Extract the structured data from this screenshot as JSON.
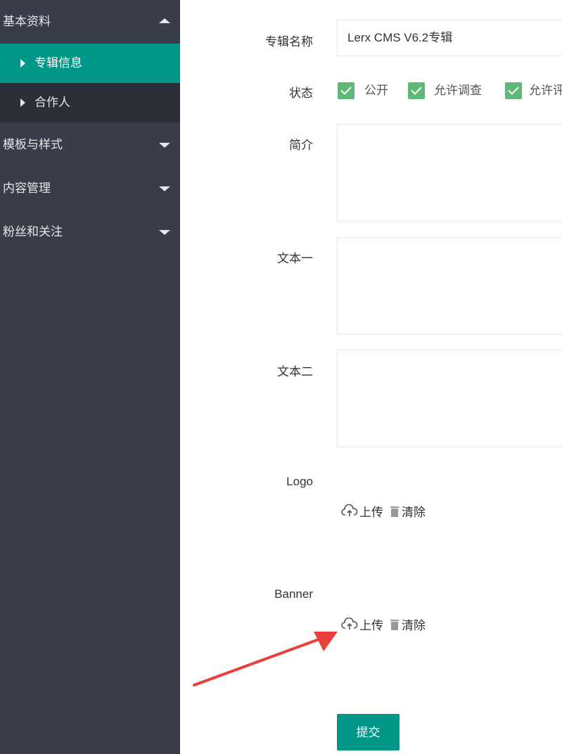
{
  "sidebar": {
    "groups": [
      {
        "label": "基本资料",
        "expanded": true,
        "children": [
          {
            "label": "专辑信息",
            "active": true
          },
          {
            "label": "合作人",
            "active": false
          }
        ]
      },
      {
        "label": "模板与样式",
        "expanded": false
      },
      {
        "label": "内容管理",
        "expanded": false
      },
      {
        "label": "粉丝和关注",
        "expanded": false
      }
    ]
  },
  "form": {
    "album_name_label": "专辑名称",
    "album_name_value": "Lerx CMS V6.2专辑",
    "status_label": "状态",
    "status_options": [
      {
        "label": "公开",
        "checked": true
      },
      {
        "label": "允许调查",
        "checked": true
      },
      {
        "label": "允许评",
        "checked": true
      }
    ],
    "intro_label": "简介",
    "text1_label": "文本一",
    "text2_label": "文本二",
    "logo_label": "Logo",
    "banner_label": "Banner",
    "upload_label": "上传",
    "clear_label": "清除",
    "submit_label": "提交"
  },
  "colors": {
    "sidebar_bg": "#393d49",
    "sidebar_child_bg": "#2b2e37",
    "accent": "#009688",
    "checkbox": "#5fb878",
    "annotation_arrow": "#e8403a"
  }
}
